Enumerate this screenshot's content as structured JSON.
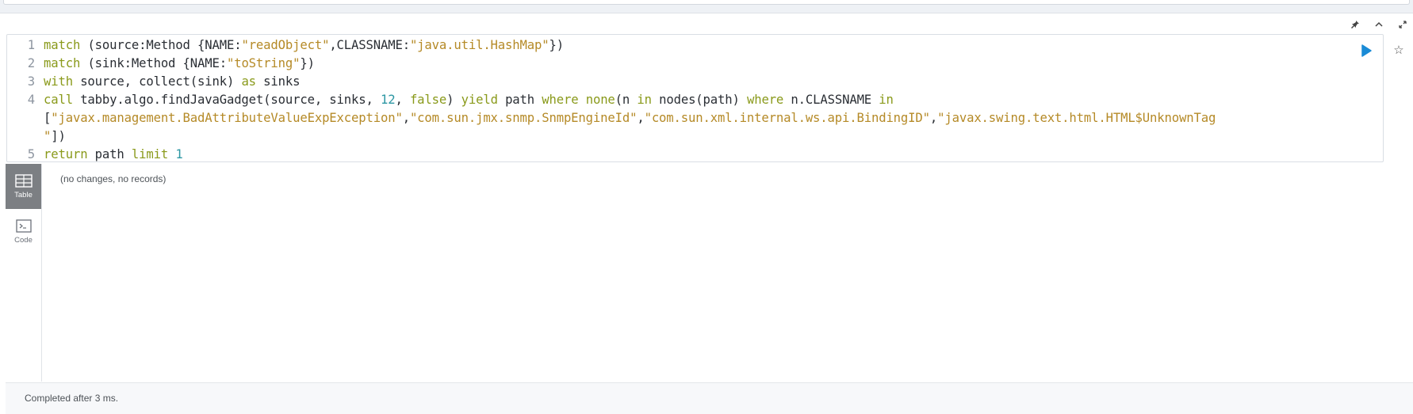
{
  "frame": {
    "controls": {
      "pin_icon": "pin-icon",
      "collapse_icon": "chevron-up-icon",
      "expand_icon": "expand-icon"
    }
  },
  "editor": {
    "lines": [
      {
        "num": "1"
      },
      {
        "num": "2"
      },
      {
        "num": "3"
      },
      {
        "num": "4"
      },
      {
        "num": ""
      },
      {
        "num": ""
      },
      {
        "num": "5"
      }
    ],
    "tokens": {
      "l1": [
        "match",
        " (source:Method {NAME:",
        "\"readObject\"",
        ",CLASSNAME:",
        "\"java.util.HashMap\"",
        "})"
      ],
      "l2": [
        "match",
        " (sink:Method {NAME:",
        "\"toString\"",
        "})"
      ],
      "l3": [
        "with",
        " source, collect(sink) ",
        "as",
        " sinks"
      ],
      "l4": [
        "call",
        " tabby.algo.findJavaGadget(source, sinks, ",
        "12",
        ", ",
        "false",
        ") ",
        "yield",
        " path ",
        "where",
        " ",
        "none",
        "(n ",
        "in",
        " nodes(path) ",
        "where",
        " n.CLASSNAME ",
        "in"
      ],
      "l4b": [
        "[",
        "\"javax.management.BadAttributeValueExpException\"",
        ",",
        "\"com.sun.jmx.snmp.SnmpEngineId\"",
        ",",
        "\"com.sun.xml.internal.ws.api.BindingID\"",
        ",",
        "\"javax.swing.text.html.HTML$UnknownTag"
      ],
      "l4c": [
        "\"",
        "])"
      ],
      "l5": [
        "return",
        " path ",
        "limit",
        " ",
        "1"
      ]
    },
    "run_icon": "play-icon",
    "star_icon": "star-icon"
  },
  "views": [
    {
      "label": "Table",
      "icon": "table-icon",
      "active": true
    },
    {
      "label": "Code",
      "icon": "terminal-icon",
      "active": false
    }
  ],
  "result": {
    "message": "(no changes, no records)"
  },
  "status": {
    "text": "Completed after 3 ms."
  },
  "colors": {
    "keyword": "#8a9a1b",
    "string": "#b58a27",
    "number": "#2d97a3",
    "run_button": "#1a8bd6",
    "active_view": "#7c7f83"
  }
}
